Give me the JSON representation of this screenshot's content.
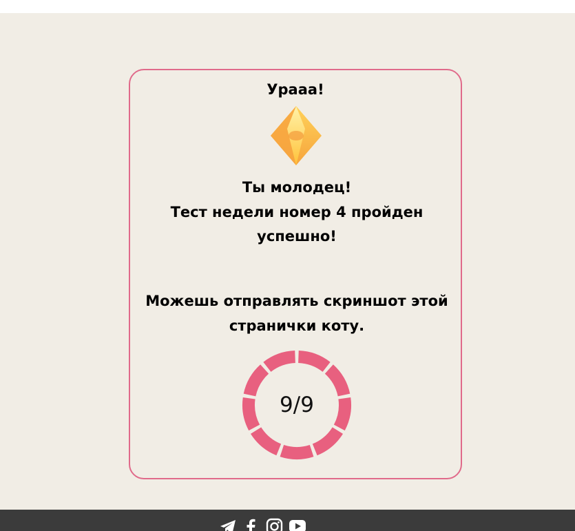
{
  "card": {
    "title": "Урааа!",
    "congrats_line1": "Ты молодец!",
    "congrats_line2": "Тест недели номер 4 пройден успешно!",
    "screenshot_line": "Можешь отправлять скриншот этой странички коту."
  },
  "score": {
    "text": "9/9",
    "correct": 9,
    "total": 9
  },
  "colors": {
    "background": "#f1ede5",
    "accent": "#e8607f",
    "footer": "#3b3b3b",
    "crystal": "#f7b04a"
  },
  "footer": {
    "social_icons": [
      "telegram-icon",
      "facebook-icon",
      "instagram-icon",
      "youtube-icon"
    ]
  }
}
